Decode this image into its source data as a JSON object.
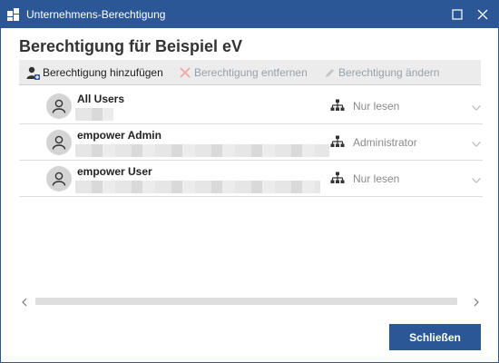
{
  "window": {
    "title": "Unternehmens-Berechtigung",
    "icons": {
      "app": "app-logo-icon",
      "maximize": "maximize-icon",
      "close": "close-icon"
    }
  },
  "page": {
    "title": "Berechtigung für Beispiel eV"
  },
  "toolbar": {
    "add_label": "Berechtigung hinzufügen",
    "remove_label": "Berechtigung entfernen",
    "edit_label": "Berechtigung ändern",
    "add_enabled": true,
    "remove_enabled": false,
    "edit_enabled": false
  },
  "permissions": [
    {
      "name": "All Users",
      "role": "Nur lesen"
    },
    {
      "name": "empower Admin",
      "role": "Administrator"
    },
    {
      "name": "empower User",
      "role": "Nur lesen"
    }
  ],
  "footer": {
    "close_label": "Schließen"
  },
  "colors": {
    "accent": "#2b5797",
    "disabled": "#9aa0a6",
    "remove_icon": "#f1a6a6"
  }
}
